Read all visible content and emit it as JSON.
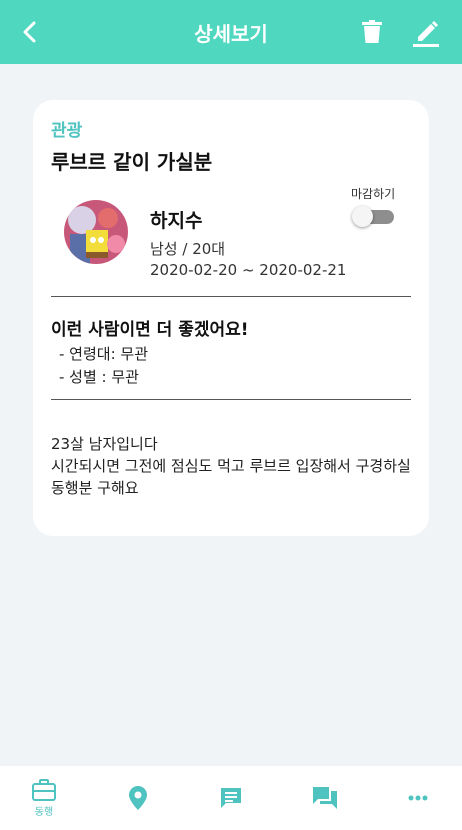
{
  "header": {
    "title": "상세보기"
  },
  "post": {
    "category": "관광",
    "title": "루브르 같이 가실분",
    "author": {
      "name": "하지수",
      "gender_age": "남성 / 20대",
      "dates": "2020-02-20 ~ 2020-02-21"
    },
    "close_label": "마감하기",
    "close_toggle_on": false,
    "preferences": {
      "title": "이런 사람이면 더 좋겠어요!",
      "items": [
        "- 연령대: 무관",
        "- 성별 : 무관"
      ]
    },
    "description": "23살 남자입니다\n시간되시면 그전에 점심도 먹고 루브르 입장해서 구경하실 동행분 구해요"
  },
  "bottom_nav": {
    "items": [
      {
        "icon": "briefcase-icon",
        "label": "동행",
        "active": true
      },
      {
        "icon": "location-pin-icon",
        "label": ""
      },
      {
        "icon": "message-icon",
        "label": ""
      },
      {
        "icon": "chat-bubbles-icon",
        "label": ""
      },
      {
        "icon": "more-dots-icon",
        "label": ""
      }
    ]
  },
  "colors": {
    "accent": "#4fd8bf",
    "category": "#4fc3c0",
    "background": "#f0f4f7"
  }
}
